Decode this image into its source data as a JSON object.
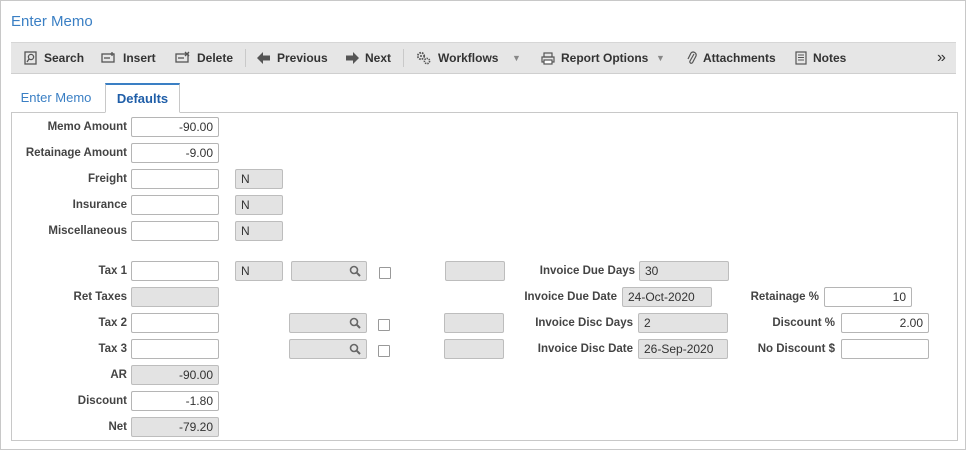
{
  "window": {
    "title": "Enter Memo"
  },
  "toolbar": {
    "search": "Search",
    "insert": "Insert",
    "delete": "Delete",
    "previous": "Previous",
    "next": "Next",
    "workflows": "Workflows",
    "report_options": "Report Options",
    "attachments": "Attachments",
    "notes": "Notes",
    "more": "»"
  },
  "tabs": [
    {
      "label": "Enter Memo",
      "active": false
    },
    {
      "label": "Defaults",
      "active": true
    }
  ],
  "form": {
    "memo_amount": {
      "label": "Memo Amount",
      "value": "-90.00"
    },
    "retainage_amount": {
      "label": "Retainage Amount",
      "value": "-9.00"
    },
    "freight": {
      "label": "Freight",
      "value": "",
      "flag": "N"
    },
    "insurance": {
      "label": "Insurance",
      "value": "",
      "flag": "N"
    },
    "miscellaneous": {
      "label": "Miscellaneous",
      "value": "",
      "flag": "N"
    },
    "tax1": {
      "label": "Tax 1",
      "value": "",
      "flag": "N",
      "lookup": "",
      "rate": ""
    },
    "ret_taxes": {
      "label": "Ret Taxes",
      "value": ""
    },
    "tax2": {
      "label": "Tax 2",
      "value": "",
      "lookup": "",
      "rate": ""
    },
    "tax3": {
      "label": "Tax 3",
      "value": "",
      "lookup": "",
      "rate": ""
    },
    "ar": {
      "label": "AR",
      "value": "-90.00"
    },
    "discount": {
      "label": "Discount",
      "value": "-1.80"
    },
    "net": {
      "label": "Net",
      "value": "-79.20"
    },
    "invoice_due_days": {
      "label": "Invoice Due Days",
      "value": "30"
    },
    "invoice_due_date": {
      "label": "Invoice Due Date",
      "value": "24-Oct-2020"
    },
    "invoice_disc_days": {
      "label": "Invoice Disc Days",
      "value": "2"
    },
    "invoice_disc_date": {
      "label": "Invoice Disc Date",
      "value": "26-Sep-2020"
    },
    "retainage_pct": {
      "label": "Retainage %",
      "value": "10"
    },
    "discount_pct": {
      "label": "Discount %",
      "value": "2.00"
    },
    "no_discount": {
      "label": "No Discount $",
      "value": ""
    }
  },
  "colors": {
    "accent": "#3a7fc4",
    "toolbar_bg": "#e6e6e6",
    "readonly_bg": "#e3e3e3"
  }
}
